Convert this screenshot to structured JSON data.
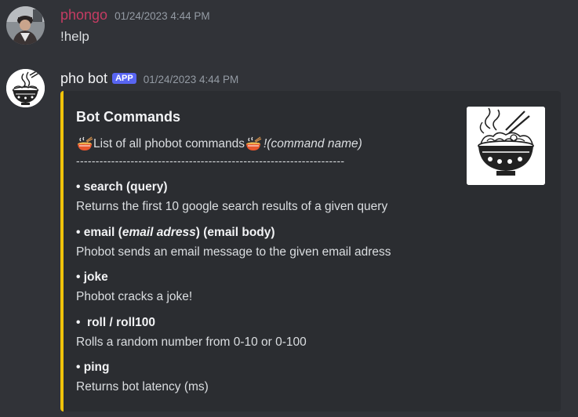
{
  "messages": [
    {
      "username": "phongo",
      "username_color": "#c53c63",
      "timestamp": "01/24/2023 4:44 PM",
      "content": "!help"
    },
    {
      "username": "pho bot",
      "username_color": "#f2f3f5",
      "badge": "APP",
      "timestamp": "01/24/2023 4:44 PM",
      "embed": {
        "accent_color": "#f0c30a",
        "title": "Bot Commands",
        "description": "List of all phobot commands",
        "command_hint": "!(command name)",
        "divider": "---------------------------------------------------------------------",
        "thumbnail_icon": "pho-bowl-icon",
        "fields": [
          {
            "name": "• search (query)",
            "value": "Returns the first 10 google search results of a given query"
          },
          {
            "name_prefix": "• email (",
            "name_italic": "email adress",
            "name_suffix": ") (email body)",
            "value": "Phobot sends an email message to the given email adress"
          },
          {
            "name": "• joke",
            "value": "Phobot cracks a joke!"
          },
          {
            "name": "•  roll / roll100",
            "value": "Rolls a random number from 0-10 or 0-100"
          },
          {
            "name": "• ping",
            "value": "Returns bot latency (ms)"
          }
        ]
      }
    }
  ]
}
